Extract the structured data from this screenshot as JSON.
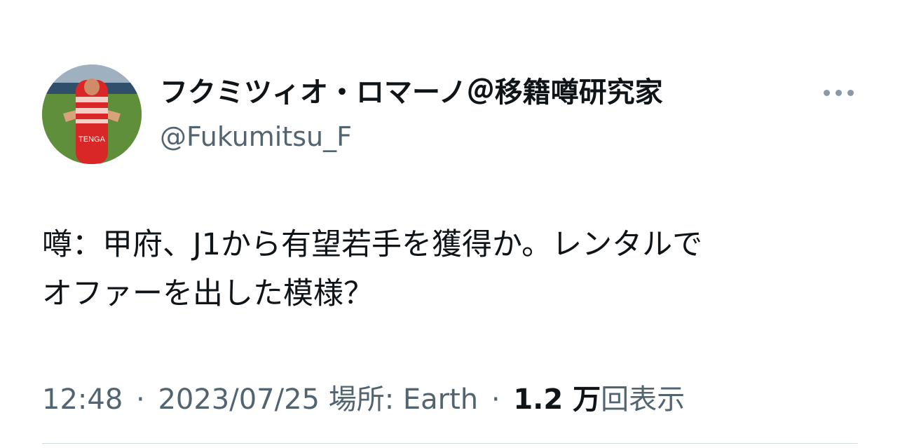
{
  "author": {
    "display_name": "フクミツィオ・ロマーノ＠移籍噂研究家",
    "handle": "@Fukumitsu_F",
    "avatar_text": "TENGA"
  },
  "tweet": {
    "lines": [
      "噂：甲府、J1から有望若手を獲得か。レンタルで",
      "オファーを出した模様？"
    ]
  },
  "meta": {
    "time": "12:48",
    "separator": "·",
    "date": "2023/07/25",
    "location": "場所: Earth",
    "views_count": "1.2 万",
    "views_label": "回表示"
  },
  "icons": {
    "more": "more-horizontal-icon"
  },
  "colors": {
    "text": "#0f1419",
    "secondary": "#536471",
    "divider": "#cfd9de"
  }
}
